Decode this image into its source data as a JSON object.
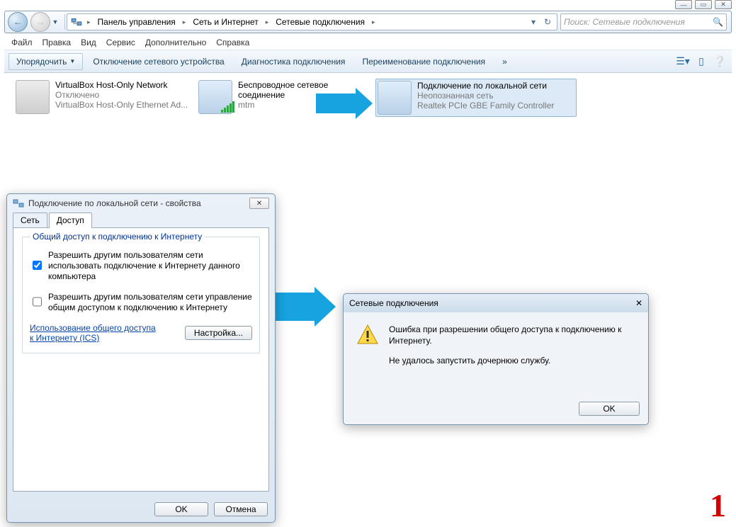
{
  "window": {
    "search_placeholder": "Поиск: Сетевые подключения"
  },
  "breadcrumb": {
    "p1": "Панель управления",
    "p2": "Сеть и Интернет",
    "p3": "Сетевые подключения"
  },
  "menu": {
    "file": "Файл",
    "edit": "Правка",
    "view": "Вид",
    "service": "Сервис",
    "extra": "Дополнительно",
    "help": "Справка"
  },
  "toolbar": {
    "organize": "Упорядочить",
    "disable": "Отключение сетевого устройства",
    "diag": "Диагностика подключения",
    "rename": "Переименование подключения",
    "more": "»"
  },
  "connections": {
    "c1": {
      "l1": "VirtualBox Host-Only Network",
      "l2": "Отключено",
      "l3": "VirtualBox Host-Only Ethernet Ad..."
    },
    "c2": {
      "l1": "Беспроводное сетевое",
      "l1b": "соединение",
      "l3": "mtm"
    },
    "c3": {
      "l1": "Подключение по локальной сети",
      "l2": "Неопознанная сеть",
      "l3": "Realtek PCIe GBE Family Controller"
    }
  },
  "prop": {
    "title": "Подключение по локальной сети - свойства",
    "tab_net": "Сеть",
    "tab_access": "Доступ",
    "group": "Общий доступ к подключению к Интернету",
    "chk1": "Разрешить другим пользователям сети использовать подключение к Интернету данного компьютера",
    "chk2": "Разрешить другим пользователям сети управление общим доступом к подключению к Интернету",
    "link": "Использование общего доступа к Интернету (ICS)",
    "settings": "Настройка...",
    "ok": "OK",
    "cancel": "Отмена"
  },
  "err": {
    "title": "Сетевые подключения",
    "line1": "Ошибка при разрешении общего доступа к подключению к Интернету.",
    "line2": "Не удалось запустить дочернюю службу.",
    "ok": "OK"
  },
  "marker": "1"
}
